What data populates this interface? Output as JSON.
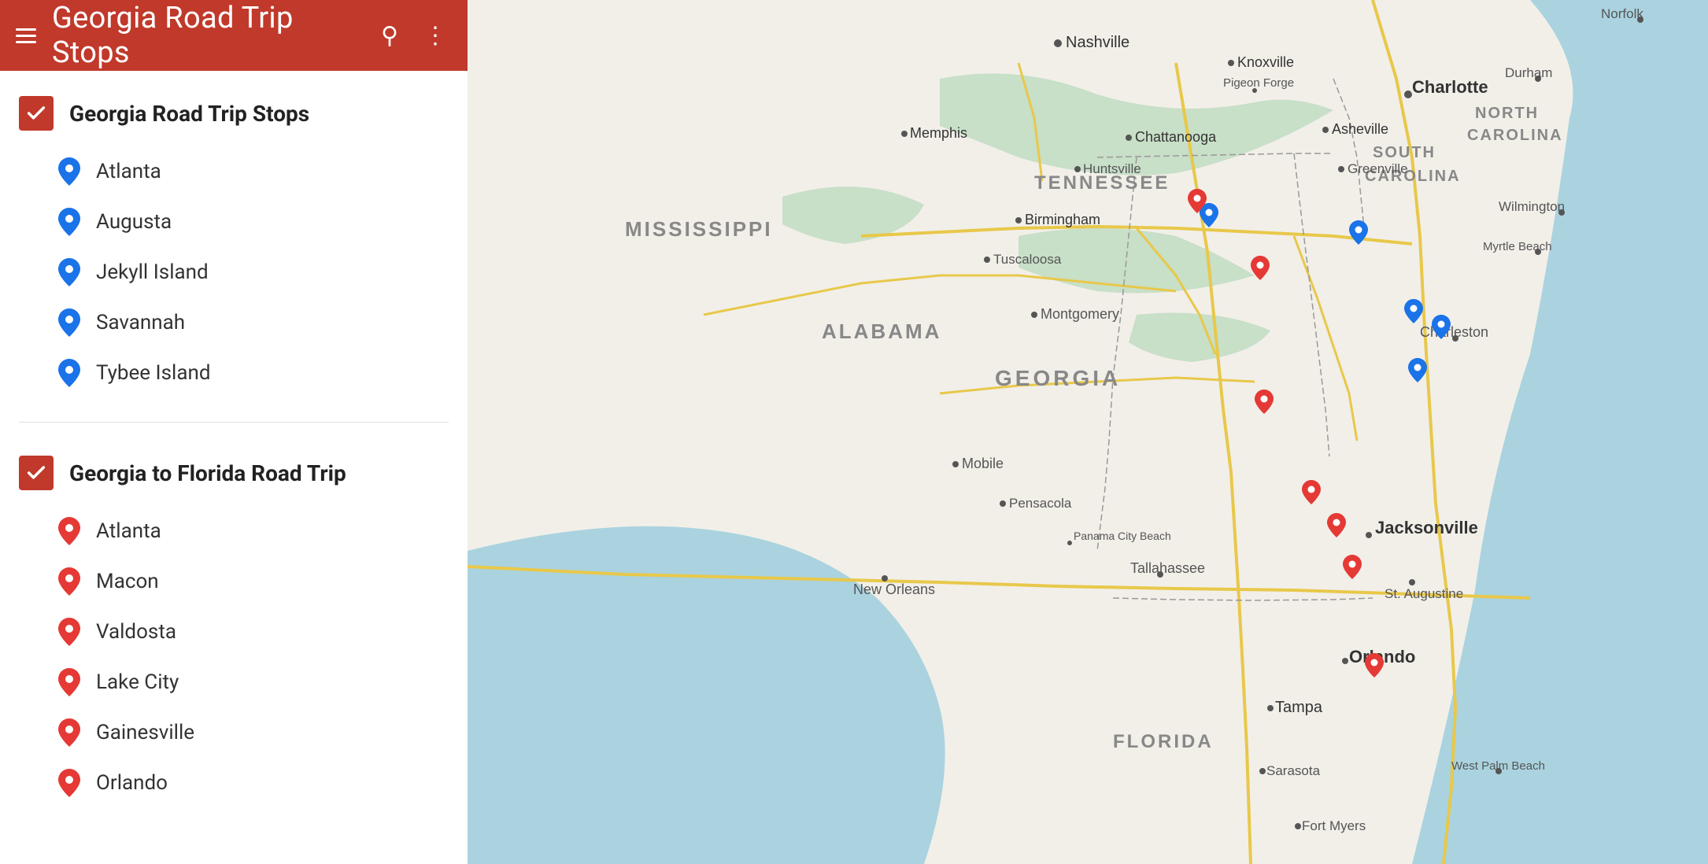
{
  "header": {
    "title": "Georgia Road Trip Stops",
    "search_label": "search",
    "menu_label": "more options"
  },
  "sections": [
    {
      "id": "section-georgia",
      "title": "Georgia Road Trip Stops",
      "color": "blue",
      "items": [
        {
          "label": "Atlanta"
        },
        {
          "label": "Augusta"
        },
        {
          "label": "Jekyll Island"
        },
        {
          "label": "Savannah"
        },
        {
          "label": "Tybee Island"
        }
      ]
    },
    {
      "id": "section-florida",
      "title": "Georgia to Florida Road Trip",
      "color": "red",
      "items": [
        {
          "label": "Atlanta"
        },
        {
          "label": "Macon"
        },
        {
          "label": "Valdosta"
        },
        {
          "label": "Lake City"
        },
        {
          "label": "Gainesville"
        },
        {
          "label": "Orlando"
        }
      ]
    }
  ],
  "map": {
    "alt": "Map of southeastern United States showing Georgia Road Trip stops"
  }
}
